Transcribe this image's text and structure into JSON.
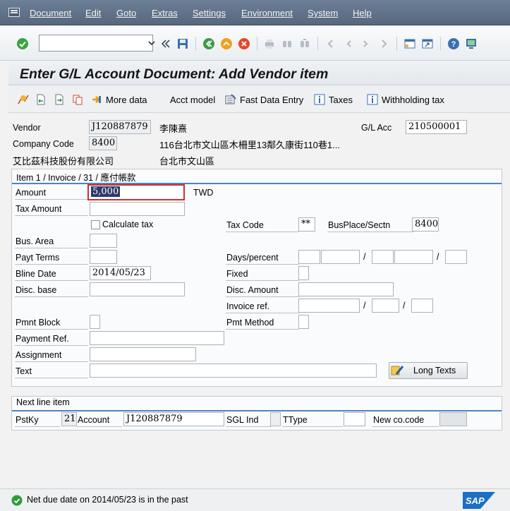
{
  "menu": {
    "items": [
      "Document",
      "Edit",
      "Goto",
      "Extras",
      "Settings",
      "Environment",
      "System",
      "Help"
    ]
  },
  "toolbar": {
    "command_value": "",
    "icons": [
      "enter-icon",
      "back-arrows-icon",
      "save-icon",
      "back-icon",
      "exit-icon",
      "cancel-icon",
      "print-icon",
      "find-icon",
      "find-next-icon",
      "first-page-icon",
      "previous-page-icon",
      "next-page-icon",
      "last-page-icon",
      "new-session-icon",
      "shortcut-icon",
      "help-icon",
      "customize-layout-icon"
    ]
  },
  "title": "Enter G/L Account Document: Add Vendor item",
  "app_toolbar": {
    "more_data": "More data",
    "acct_model": "Acct model",
    "fast_data_entry": "Fast Data Entry",
    "taxes": "Taxes",
    "withholding_tax": "Withholding tax"
  },
  "header": {
    "vendor_label": "Vendor",
    "vendor_value": "J120887879",
    "vendor_name": "李陳熹",
    "gl_acc_label": "G/L Acc",
    "gl_acc_value": "210500001",
    "company_code_label": "Company Code",
    "company_code_value": "8400",
    "vendor_address": "116台北市文山區木柵里13鄰久康街110巷1...",
    "company_name": "艾比茲科技股份有限公司",
    "vendor_city": "台北市文山區"
  },
  "item": {
    "group_title": "Item 1 / Invoice / 31 / 應付帳款",
    "amount_label": "Amount",
    "amount_value": "5,000",
    "currency": "TWD",
    "tax_amount_label": "Tax Amount",
    "calculate_tax_label": "Calculate tax",
    "calculate_tax_checked": false,
    "tax_code_label": "Tax Code",
    "tax_code_value": "**",
    "busplace_label": "BusPlace/Sectn",
    "busplace_value": "8400",
    "bus_area_label": "Bus. Area",
    "payt_terms_label": "Payt Terms",
    "days_percent_label": "Days/percent",
    "slash": "/",
    "bline_date_label": "Bline Date",
    "bline_date_value": "2014/05/23",
    "fixed_label": "Fixed",
    "disc_base_label": "Disc. base",
    "disc_amount_label": "Disc. Amount",
    "invoice_ref_label": "Invoice ref.",
    "pmnt_block_label": "Pmnt Block",
    "pmt_method_label": "Pmt Method",
    "payment_ref_label": "Payment Ref.",
    "assignment_label": "Assignment",
    "text_label": "Text",
    "long_texts_label": "Long Texts"
  },
  "next_line": {
    "group_title": "Next line item",
    "pstky_label": "PstKy",
    "pstky_value": "21",
    "account_label": "Account",
    "account_value": "J120887879",
    "sgl_ind_label": "SGL Ind",
    "ttype_label": "TType",
    "new_cocode_label": "New co.code"
  },
  "status": {
    "message": "Net due date on 2014/05/23 is in the past",
    "type": "success"
  },
  "colors": {
    "menu_bar": "#5f7189",
    "group_line": "#4b86c1",
    "status_ok": "#2e9b3a",
    "sap_logo": "#1c6fc4"
  }
}
